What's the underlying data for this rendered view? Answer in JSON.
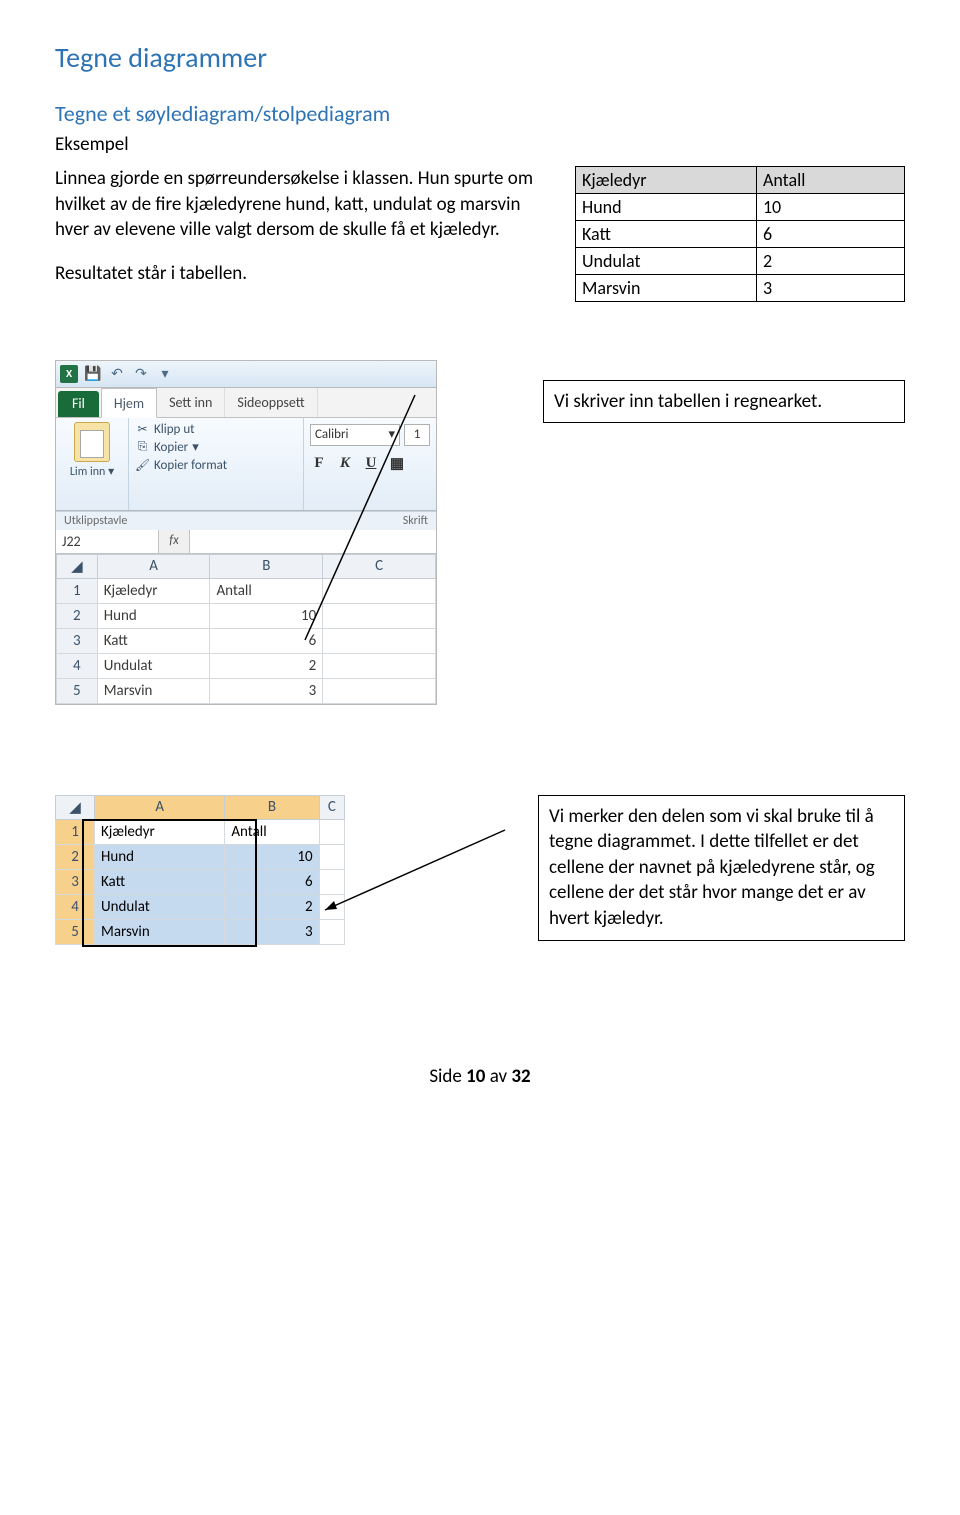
{
  "headings": {
    "h1": "Tegne diagrammer",
    "h2": "Tegne et søylediagram/stolpediagram",
    "eksempel": "Eksempel"
  },
  "paragraphs": {
    "p1": "Linnea gjorde en spørreundersøkelse i klassen. Hun spurte om hvilket av de fire kjæledyrene hund, katt, undulat og marsvin hver av elevene ville valgt dersom de skulle få et kjæledyr.",
    "p2": "Resultatet står i tabellen."
  },
  "data_table": {
    "headers": [
      "Kjæledyr",
      "Antall"
    ],
    "rows": [
      [
        "Hund",
        "10"
      ],
      [
        "Katt",
        "6"
      ],
      [
        "Undulat",
        "2"
      ],
      [
        "Marsvin",
        "3"
      ]
    ]
  },
  "chart_data": {
    "type": "table",
    "categories": [
      "Hund",
      "Katt",
      "Undulat",
      "Marsvin"
    ],
    "values": [
      10,
      6,
      2,
      3
    ],
    "xlabel": "Kjæledyr",
    "ylabel": "Antall"
  },
  "excel": {
    "tabs": {
      "file": "Fil",
      "home": "Hjem",
      "insert": "Sett inn",
      "layout": "Sideoppsett"
    },
    "clipboard": {
      "paste": "Lim inn",
      "cut": "Klipp ut",
      "copy": "Kopier",
      "format": "Kopier format",
      "group": "Utklippstavle"
    },
    "font": {
      "name": "Calibri",
      "size": "1",
      "group": "Skrift"
    },
    "namebox": "J22",
    "fx": "fx",
    "columns": [
      "",
      "A",
      "B",
      "C"
    ],
    "rows": [
      [
        "1",
        "Kjæledyr",
        "Antall",
        ""
      ],
      [
        "2",
        "Hund",
        "10",
        ""
      ],
      [
        "3",
        "Katt",
        "6",
        ""
      ],
      [
        "4",
        "Undulat",
        "2",
        ""
      ],
      [
        "5",
        "Marsvin",
        "3",
        ""
      ]
    ]
  },
  "callouts": {
    "c1": "Vi skriver inn tabellen i regnearket.",
    "c2": "Vi merker den delen som vi skal bruke til å tegne diagrammet. I dette tilfellet er det cellene der navnet på kjæledyrene står, og cellene der det står hvor mange det er av hvert kjæledyr."
  },
  "excel_sel": {
    "columns": [
      "",
      "A",
      "B",
      "C"
    ],
    "rows": [
      [
        "1",
        "Kjæledyr",
        "Antall",
        ""
      ],
      [
        "2",
        "Hund",
        "10",
        ""
      ],
      [
        "3",
        "Katt",
        "6",
        ""
      ],
      [
        "4",
        "Undulat",
        "2",
        ""
      ],
      [
        "5",
        "Marsvin",
        "3",
        ""
      ]
    ]
  },
  "footer": {
    "prefix": "Side ",
    "page": "10",
    "of": " av ",
    "total": "32"
  }
}
